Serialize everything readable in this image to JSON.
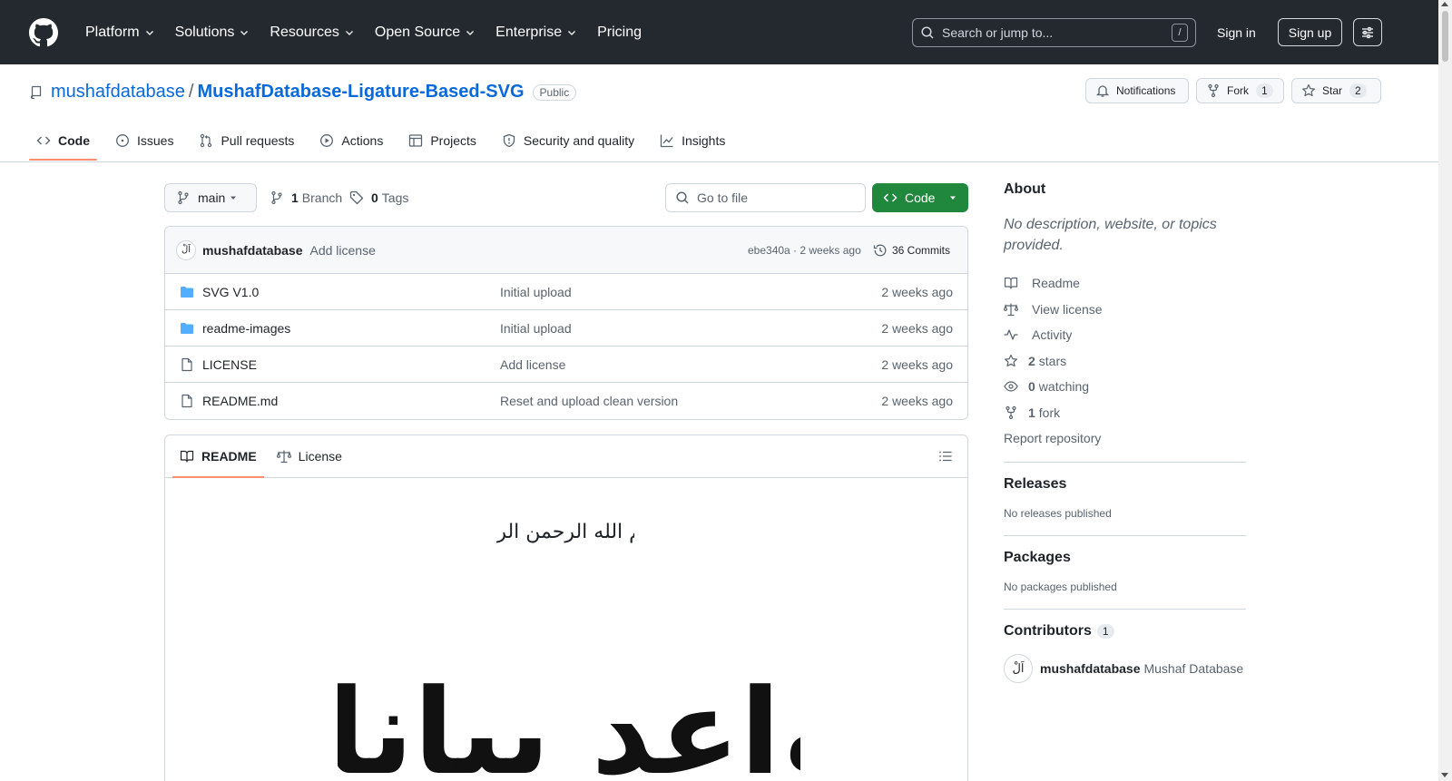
{
  "header": {
    "nav": [
      {
        "label": "Platform",
        "chevron": true
      },
      {
        "label": "Solutions",
        "chevron": true
      },
      {
        "label": "Resources",
        "chevron": true
      },
      {
        "label": "Open Source",
        "chevron": true
      },
      {
        "label": "Enterprise",
        "chevron": true
      },
      {
        "label": "Pricing",
        "chevron": false
      }
    ],
    "search_placeholder": "Search or jump to...",
    "search_kbd": "/",
    "sign_in": "Sign in",
    "sign_up": "Sign up"
  },
  "repo": {
    "owner": "mushafdatabase",
    "separator": "/",
    "name": "MushafDatabase-Ligature-Based-SVG",
    "visibility": "Public",
    "notifications_label": "Notifications",
    "fork_label": "Fork",
    "fork_count": "1",
    "star_label": "Star",
    "star_count": "2"
  },
  "tabs": [
    {
      "label": "Code",
      "icon": "code-icon",
      "active": true
    },
    {
      "label": "Issues",
      "icon": "issue-icon",
      "active": false
    },
    {
      "label": "Pull requests",
      "icon": "pull-request-icon",
      "active": false
    },
    {
      "label": "Actions",
      "icon": "play-icon",
      "active": false
    },
    {
      "label": "Projects",
      "icon": "table-icon",
      "active": false
    },
    {
      "label": "Security and quality",
      "icon": "shield-icon",
      "active": false
    },
    {
      "label": "Insights",
      "icon": "graph-icon",
      "active": false
    }
  ],
  "filenav": {
    "branch": "main",
    "branch_count": "1",
    "branch_label": "Branch",
    "tag_count": "0",
    "tag_label": "Tags",
    "goto_placeholder": "Go to file",
    "code_button": "Code"
  },
  "commit": {
    "avatar_glyph": "اَلْ",
    "author": "mushafdatabase",
    "message": "Add license",
    "meta": "ebe340a · 2 weeks ago",
    "count_label": "36 Commits"
  },
  "files": [
    {
      "type": "folder",
      "name": "SVG V1.0",
      "commit": "Initial upload",
      "age": "2 weeks ago"
    },
    {
      "type": "folder",
      "name": "readme-images",
      "commit": "Initial upload",
      "age": "2 weeks ago"
    },
    {
      "type": "file",
      "name": "LICENSE",
      "commit": "Add license",
      "age": "2 weeks ago"
    },
    {
      "type": "file",
      "name": "README.md",
      "commit": "Reset and upload clean version",
      "age": "2 weeks ago"
    }
  ],
  "readme": {
    "tab_readme": "README",
    "tab_license": "License",
    "basmala": "بسم الله الرحمن الرحيم",
    "calligraphy": "قواعد بيانات"
  },
  "sidebar": {
    "about_title": "About",
    "description": "No description, website, or topics provided.",
    "links": [
      {
        "icon": "book-icon",
        "count": "",
        "label": "Readme"
      },
      {
        "icon": "law-icon",
        "count": "",
        "label": "View license"
      },
      {
        "icon": "pulse-icon",
        "count": "",
        "label": "Activity"
      },
      {
        "icon": "star-icon",
        "count": "2",
        "label": "stars"
      },
      {
        "icon": "eye-icon",
        "count": "0",
        "label": "watching"
      },
      {
        "icon": "fork-icon",
        "count": "1",
        "label": "fork"
      }
    ],
    "report": "Report repository",
    "releases_title": "Releases",
    "releases_text": "No releases published",
    "packages_title": "Packages",
    "packages_text": "No packages published",
    "contributors_title": "Contributors",
    "contributors_count": "1",
    "contributor_login": "mushafdatabase",
    "contributor_name": "Mushaf Database",
    "contributor_avatar_glyph": "اَلْ"
  },
  "colors": {
    "header_bg": "#24292f",
    "link": "#0969da",
    "code_button": "#1f883d",
    "active_tab_underline": "#fd8c73",
    "folder": "#54aeff"
  }
}
